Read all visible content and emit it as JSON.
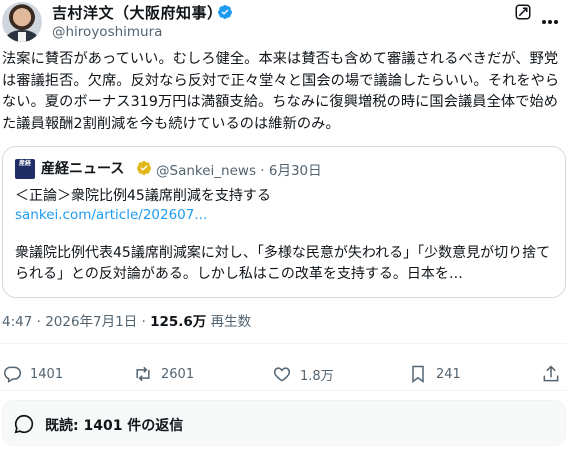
{
  "author": {
    "name": "吉村洋文（大阪府知事）",
    "handle": "@hiroyoshimura",
    "verified_color": "#1d9bf0"
  },
  "tweet": {
    "text": "法案に賛否があっていい。むしろ健全。本来は賛否も含めて審議されるべきだが、野党は審議拒否。欠席。反対なら反対で正々堂々と国会の場で議論したらいい。それをやらない。夏のボーナス319万円は満額支給。ちなみに復興増税の時に国会議員全体で始めた議員報酬2割削減を今も続けているのは維新のみ。"
  },
  "quote": {
    "avatar_text": "産経",
    "name": "産経ニュース",
    "handle_date": "@Sankei_news · 6月30日",
    "title": "＜正論＞衆院比例45議席削減を支持する",
    "link": "sankei.com/article/202607...",
    "text": "衆議院比例代表45議席削減案に対し、「多様な民意が失われる」「少数意見が切り捨てられる」との反対論がある。しかし私はこの改革を支持する。日本を…",
    "gold_badge_color": "#e2b719"
  },
  "meta": {
    "time_date": "4:47 · 2026年7月1日 · ",
    "views": "125.6万",
    "views_label": " 再生数"
  },
  "actions": {
    "replies": "1401",
    "reposts": "2601",
    "likes": "1.8万",
    "bookmarks": "241"
  },
  "readers": {
    "label": "既読: 1401 件の返信"
  }
}
